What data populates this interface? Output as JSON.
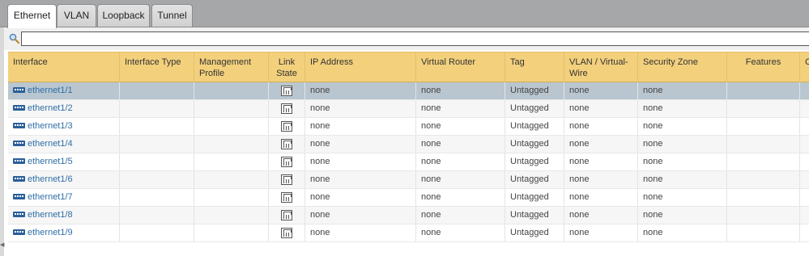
{
  "tabs": [
    {
      "label": "Ethernet",
      "active": true
    },
    {
      "label": "VLAN",
      "active": false
    },
    {
      "label": "Loopback",
      "active": false
    },
    {
      "label": "Tunnel",
      "active": false
    }
  ],
  "search": {
    "placeholder": "",
    "value": ""
  },
  "table": {
    "headers": {
      "interface": "Interface",
      "interface_type": "Interface Type",
      "management_profile": "Management Profile",
      "link_state": "Link State",
      "ip_address": "IP Address",
      "virtual_router": "Virtual Router",
      "tag": "Tag",
      "vlan_vwire": "VLAN / Virtual-Wire",
      "security_zone": "Security Zone",
      "features": "Features",
      "comment_partial": "C"
    },
    "rows": [
      {
        "interface": "ethernet1/1",
        "interface_type": "",
        "management_profile": "",
        "ip_address": "none",
        "virtual_router": "none",
        "tag": "Untagged",
        "vlan_vwire": "none",
        "security_zone": "none",
        "features": "",
        "selected": true
      },
      {
        "interface": "ethernet1/2",
        "interface_type": "",
        "management_profile": "",
        "ip_address": "none",
        "virtual_router": "none",
        "tag": "Untagged",
        "vlan_vwire": "none",
        "security_zone": "none",
        "features": ""
      },
      {
        "interface": "ethernet1/3",
        "interface_type": "",
        "management_profile": "",
        "ip_address": "none",
        "virtual_router": "none",
        "tag": "Untagged",
        "vlan_vwire": "none",
        "security_zone": "none",
        "features": ""
      },
      {
        "interface": "ethernet1/4",
        "interface_type": "",
        "management_profile": "",
        "ip_address": "none",
        "virtual_router": "none",
        "tag": "Untagged",
        "vlan_vwire": "none",
        "security_zone": "none",
        "features": ""
      },
      {
        "interface": "ethernet1/5",
        "interface_type": "",
        "management_profile": "",
        "ip_address": "none",
        "virtual_router": "none",
        "tag": "Untagged",
        "vlan_vwire": "none",
        "security_zone": "none",
        "features": ""
      },
      {
        "interface": "ethernet1/6",
        "interface_type": "",
        "management_profile": "",
        "ip_address": "none",
        "virtual_router": "none",
        "tag": "Untagged",
        "vlan_vwire": "none",
        "security_zone": "none",
        "features": ""
      },
      {
        "interface": "ethernet1/7",
        "interface_type": "",
        "management_profile": "",
        "ip_address": "none",
        "virtual_router": "none",
        "tag": "Untagged",
        "vlan_vwire": "none",
        "security_zone": "none",
        "features": ""
      },
      {
        "interface": "ethernet1/8",
        "interface_type": "",
        "management_profile": "",
        "ip_address": "none",
        "virtual_router": "none",
        "tag": "Untagged",
        "vlan_vwire": "none",
        "security_zone": "none",
        "features": ""
      },
      {
        "interface": "ethernet1/9",
        "interface_type": "",
        "management_profile": "",
        "ip_address": "none",
        "virtual_router": "none",
        "tag": "Untagged",
        "vlan_vwire": "none",
        "security_zone": "none",
        "features": ""
      }
    ]
  },
  "icons": {
    "search": "search-icon",
    "interface": "ethernet-port-icon",
    "link_state": "link-state-icon"
  },
  "colors": {
    "header_bg": "#f3d07c",
    "link": "#2f6fa8",
    "selected_row": "#b9c6cf",
    "tabbar_bg": "#a6a7a8"
  }
}
